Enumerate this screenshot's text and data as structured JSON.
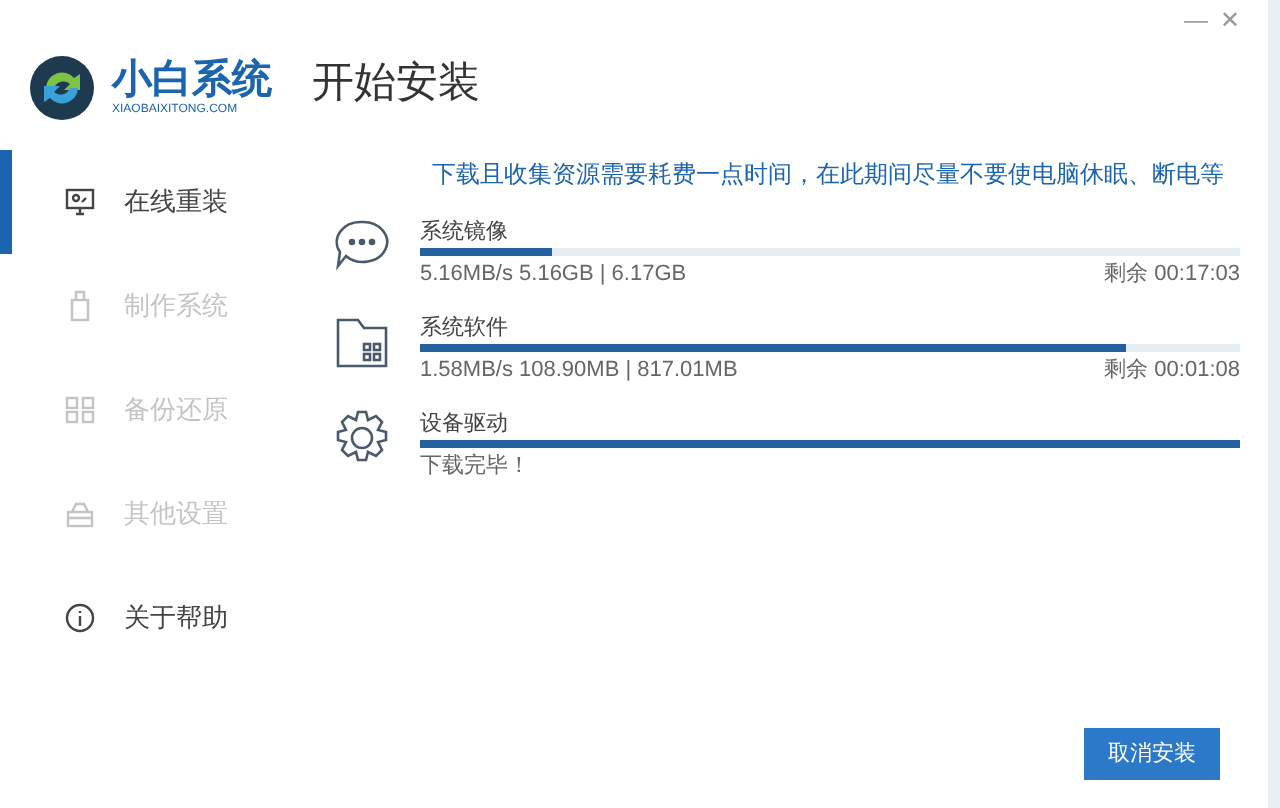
{
  "logo": {
    "name": "小白系统",
    "domain": "XIAOBAIXITONG.COM"
  },
  "title": "开始安装",
  "window_controls": [
    "—",
    "✕"
  ],
  "sidebar": {
    "items": [
      {
        "label": "在线重装",
        "selected": true,
        "disabled": false
      },
      {
        "label": "制作系统",
        "selected": false,
        "disabled": true
      },
      {
        "label": "备份还原",
        "selected": false,
        "disabled": true
      },
      {
        "label": "其他设置",
        "selected": false,
        "disabled": true
      },
      {
        "label": "关于帮助",
        "selected": false,
        "disabled": false
      }
    ]
  },
  "notice": "下载且收集资源需要耗费一点时间，在此期间尽量不要使电脑休眠、断电等",
  "downloads": [
    {
      "name": "系统镜像",
      "level": 0.16,
      "status": "5.16MB/s 5.16GB | 6.17GB",
      "remaining": "剩余 00:17:03"
    },
    {
      "name": "系统软件",
      "level": 0.86,
      "status": "1.58MB/s 108.90MB | 817.01MB",
      "remaining": "剩余 00:01:08"
    },
    {
      "name": "设备驱动",
      "level": 1,
      "status": "下载完毕！"
    }
  ],
  "buttons": [
    {
      "label": "取消安装"
    }
  ]
}
